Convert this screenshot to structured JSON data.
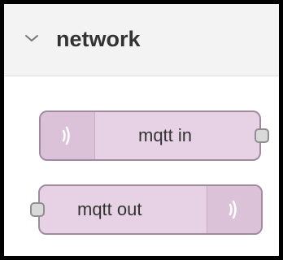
{
  "palette": {
    "category": {
      "title": "network",
      "expanded_icon": "chevron-down-icon"
    },
    "nodes": [
      {
        "label": "mqtt in",
        "icon": "wireless-signal-icon",
        "port": "output"
      },
      {
        "label": "mqtt out",
        "icon": "wireless-signal-icon",
        "port": "input"
      }
    ]
  },
  "colors": {
    "node_fill": "#e7d2e5",
    "node_border": "#a08a9f",
    "icon_cell": "#dcc2d9",
    "icon_stroke": "#ffffff",
    "header_bg": "#f3f3f3"
  }
}
